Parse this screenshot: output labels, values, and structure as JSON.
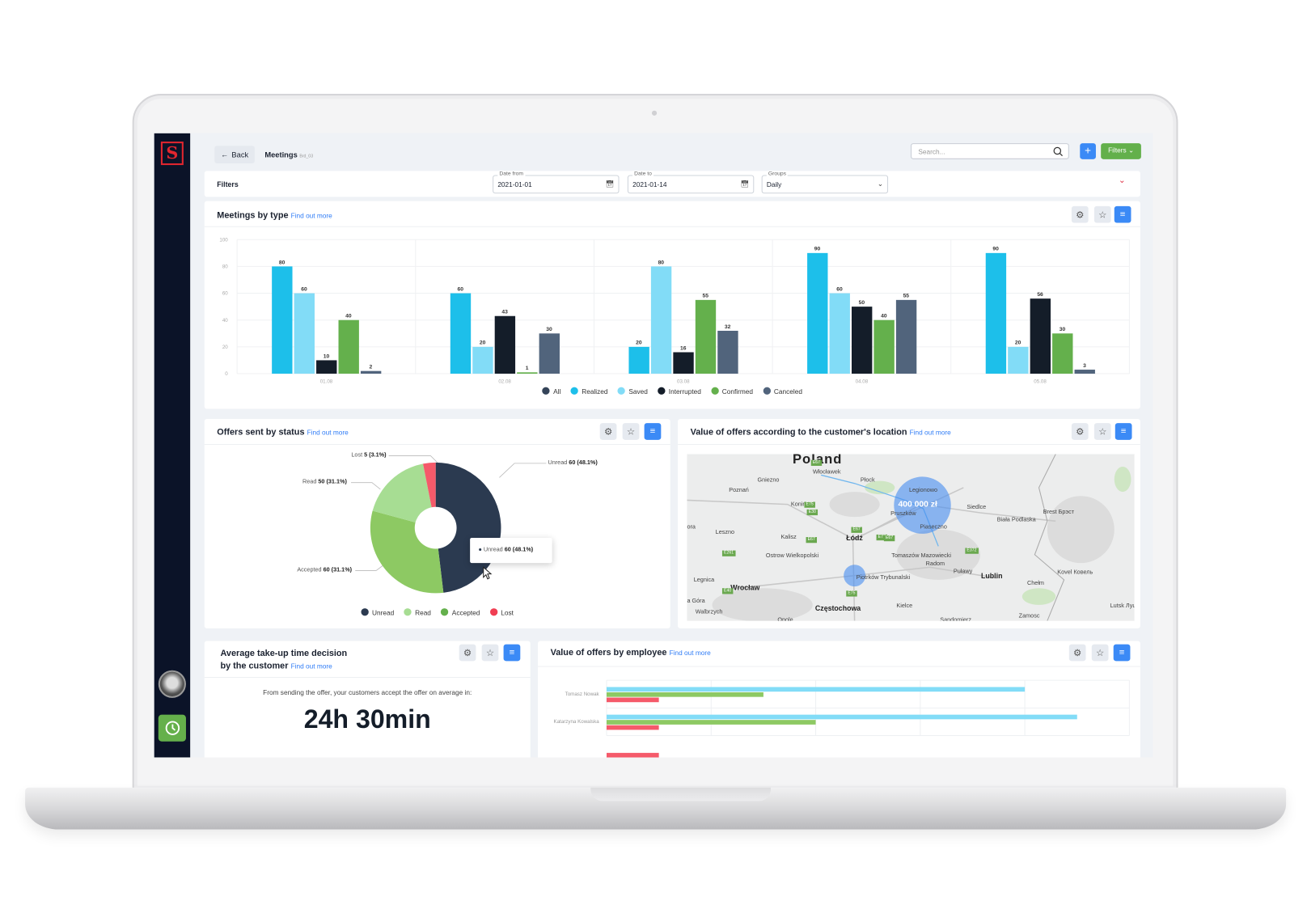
{
  "header": {
    "back_label": "Back",
    "title": "Meetings",
    "title_code": "Brd_03",
    "search_placeholder": "Search...",
    "add_label": "+",
    "filters_label": "Filters"
  },
  "filters": {
    "label": "Filters",
    "date_from": {
      "label": "Date from",
      "value": "2021-01-01"
    },
    "date_to": {
      "label": "Date to",
      "value": "2021-01-14"
    },
    "groups": {
      "label": "Groups",
      "value": "Daily"
    }
  },
  "find_out_more": "Find out more",
  "meetings": {
    "title": "Meetings by type"
  },
  "offers": {
    "title": "Offers sent by status",
    "tooltip": {
      "name": "Unread",
      "value": "60 (48.1%)"
    }
  },
  "map": {
    "title": "Value of offers according to the customer's location",
    "country": "Poland",
    "bubble_label": "400 000 zł",
    "cities": [
      "Włocławek",
      "Płock",
      "Gniezno",
      "Poznań",
      "Konin",
      "Legionowo",
      "Pruszków",
      "Piaseczno",
      "Siedlce",
      "Biała Podlaska",
      "Brest Брэст",
      "Leszno",
      "Kalisz",
      "Łódź",
      "Ostrow Wielkopolski",
      "Tomaszów Mazowiecki",
      "Radom",
      "Puławy",
      "Lublin",
      "Chełm",
      "Kovel Ковель",
      "Legnica",
      "Wrocław",
      "Piotrków Trybunalski",
      "Kielce",
      "Częstochowa",
      "Zamosc",
      "Walbrzych",
      "Lutsk Луцьк",
      "a Góra",
      "ora",
      "Opole",
      "Sandomierz"
    ],
    "roads": [
      "E67",
      "E75",
      "E30",
      "E261",
      "E67",
      "E77",
      "E372",
      "E67",
      "E40",
      "E75",
      "E67"
    ]
  },
  "avg": {
    "title_line1": "Average take-up time decision",
    "title_line2": "by the customer",
    "text": "From sending the offer, your customers accept the offer on average in:",
    "value": "24h 30min"
  },
  "employee": {
    "title": "Value of offers by employee"
  },
  "colors": {
    "accent": "#3b8af6",
    "green": "#63b04b",
    "sidebar": "#0b1328"
  },
  "chart_data": [
    {
      "type": "bar",
      "title": "Meetings by type",
      "categories": [
        "01.08",
        "02.08",
        "03.08",
        "04.08",
        "05.08"
      ],
      "ylim": [
        0,
        100
      ],
      "yticks": [
        0,
        20,
        40,
        60,
        80,
        100
      ],
      "grid": true,
      "legend": "bottom",
      "legend_entries": [
        {
          "name": "All",
          "color": "#344459"
        },
        {
          "name": "Realized",
          "color": "#1dbfea"
        },
        {
          "name": "Saved",
          "color": "#82dcf7"
        },
        {
          "name": "Interrupted",
          "color": "#141d29"
        },
        {
          "name": "Confirmed",
          "color": "#64b04c"
        },
        {
          "name": "Canceled",
          "color": "#51647c"
        }
      ],
      "series": [
        {
          "name": "Realized",
          "color": "#1dbfea",
          "values": [
            80,
            60,
            20,
            90,
            90
          ]
        },
        {
          "name": "Saved",
          "color": "#82dcf7",
          "values": [
            60,
            20,
            80,
            60,
            20
          ]
        },
        {
          "name": "Interrupted",
          "color": "#141d29",
          "values": [
            10,
            43,
            16,
            50,
            56
          ]
        },
        {
          "name": "Confirmed",
          "color": "#64b04c",
          "values": [
            40,
            1,
            55,
            40,
            30
          ]
        },
        {
          "name": "Canceled",
          "color": "#51647c",
          "values": [
            2,
            30,
            32,
            55,
            3
          ]
        }
      ]
    },
    {
      "type": "pie",
      "title": "Offers sent by status",
      "donut": true,
      "legend": "bottom",
      "slices": [
        {
          "name": "Unread",
          "value": 60,
          "percent": 48.1,
          "label": "60 (48.1%)",
          "color": "#2b3a50"
        },
        {
          "name": "Accepted",
          "value": 60,
          "percent": 31.1,
          "label": "60 (31.1%)",
          "color": "#8dc963"
        },
        {
          "name": "Read",
          "value": 50,
          "percent": 31.1,
          "label": "50 (31.1%)",
          "color": "#a7dd93"
        },
        {
          "name": "Lost",
          "value": 5,
          "percent": 3.1,
          "label": "5 (3.1%)",
          "color": "#f55a6a"
        }
      ],
      "legend_entries": [
        {
          "name": "Unread",
          "color": "#2b3a50"
        },
        {
          "name": "Read",
          "color": "#a7dd93"
        },
        {
          "name": "Accepted",
          "color": "#64b04c"
        },
        {
          "name": "Lost",
          "color": "#f03e53"
        }
      ]
    },
    {
      "type": "bar",
      "orientation": "horizontal",
      "title": "Value of offers by employee",
      "xlim": [
        0,
        100
      ],
      "grid": true,
      "categories": [
        "Tomasz Nowak",
        "Katarzyna Kowalska",
        ""
      ],
      "series": [
        {
          "color": "#82dcf7",
          "values": [
            80,
            90,
            null
          ]
        },
        {
          "color": "#8dc963",
          "values": [
            30,
            40,
            null
          ]
        },
        {
          "color": "#f55a6a",
          "values": [
            10,
            10,
            10
          ]
        }
      ]
    }
  ]
}
